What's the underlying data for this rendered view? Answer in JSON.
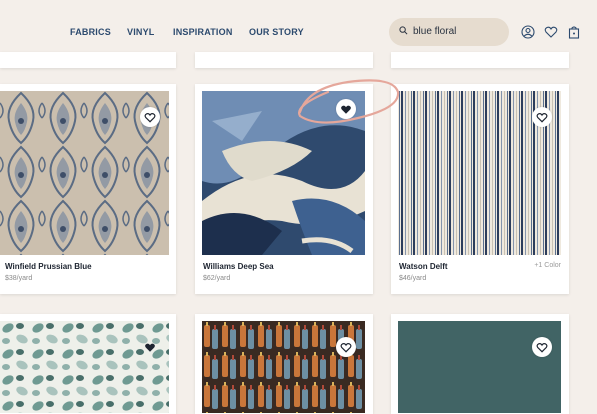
{
  "nav": {
    "items": [
      "FABRICS",
      "VINYL",
      "INSPIRATION",
      "OUR STORY"
    ]
  },
  "search": {
    "value": "blue floral"
  },
  "header_icons": [
    "account-icon",
    "heart-icon",
    "cart-icon"
  ],
  "products": [
    {
      "name": "Winfield Prussian Blue",
      "price": "$38/yard",
      "extra": "",
      "favorited": false
    },
    {
      "name": "Williams Deep Sea",
      "price": "$62/yard",
      "extra": "",
      "favorited": true
    },
    {
      "name": "Watson Delft",
      "price": "$46/yard",
      "extra": "+1 Color",
      "favorited": false
    },
    {
      "name": "",
      "price": "",
      "extra": "",
      "favorited": true
    },
    {
      "name": "",
      "price": "",
      "extra": "",
      "favorited": false
    },
    {
      "name": "",
      "price": "",
      "extra": "",
      "favorited": false
    }
  ],
  "colors": {
    "nav": "#2c4a6e",
    "background": "#f4efea",
    "search_bg": "#e6dccf",
    "annotation": "#e5a79b"
  }
}
